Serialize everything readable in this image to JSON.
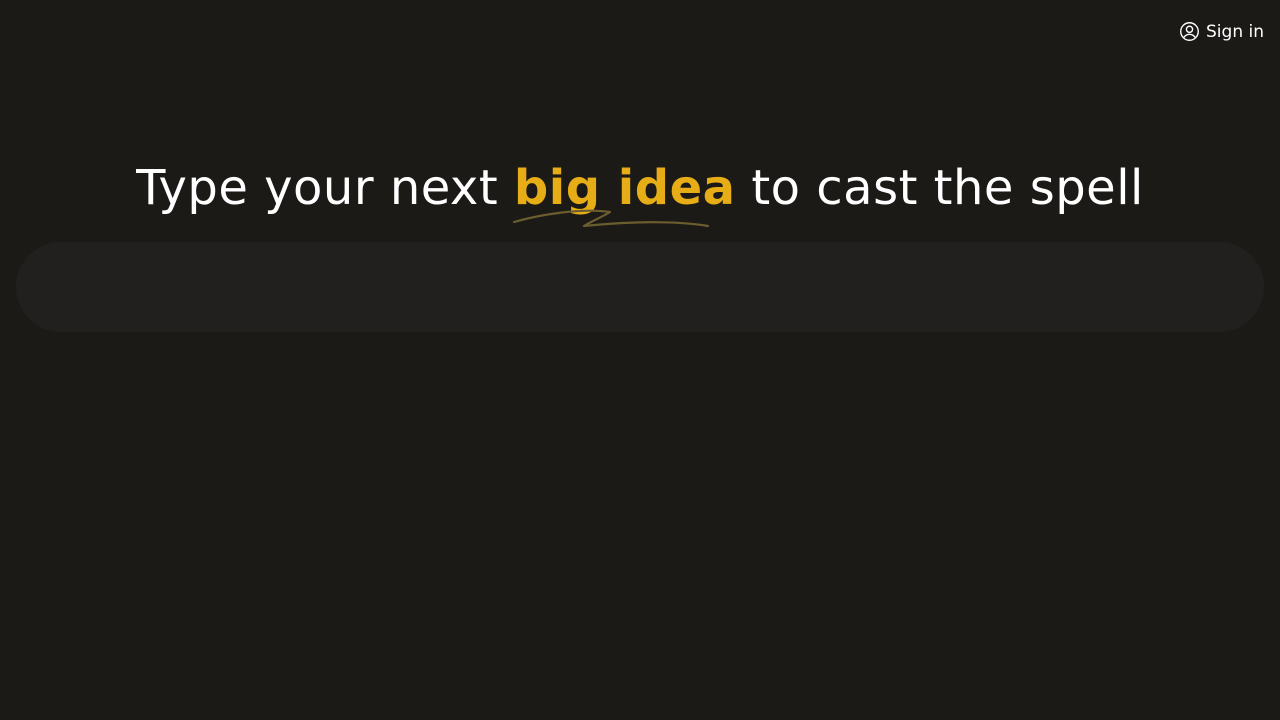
{
  "header": {
    "signin_label": "Sign in",
    "signin_icon": "user-circle-icon"
  },
  "hero": {
    "headline_before": "Type your next",
    "headline_accent": "big idea",
    "headline_after": "to cast the spell",
    "accent_color": "#e6ad17"
  },
  "prompt": {
    "value": "",
    "placeholder": ""
  },
  "theme": {
    "background": "#1c1a17",
    "input_background": "#21201e",
    "text": "#ffffff"
  }
}
